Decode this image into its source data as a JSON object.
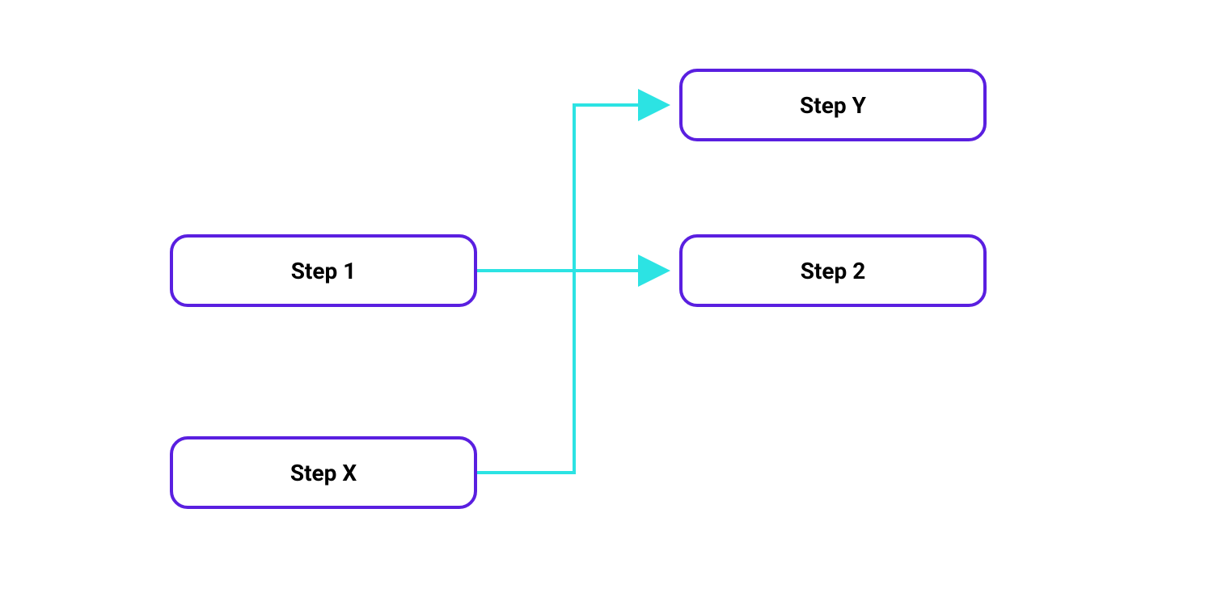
{
  "diagram": {
    "nodes": {
      "step1": {
        "label": "Step 1"
      },
      "stepX": {
        "label": "Step X"
      },
      "stepY": {
        "label": "Step Y"
      },
      "step2": {
        "label": "Step 2"
      }
    },
    "colors": {
      "node_border": "#5a1fe0",
      "arrow": "#2ce3e3"
    },
    "connections": [
      {
        "from": "step1",
        "to": "step2"
      },
      {
        "from": "stepX",
        "to": "stepY"
      }
    ]
  }
}
